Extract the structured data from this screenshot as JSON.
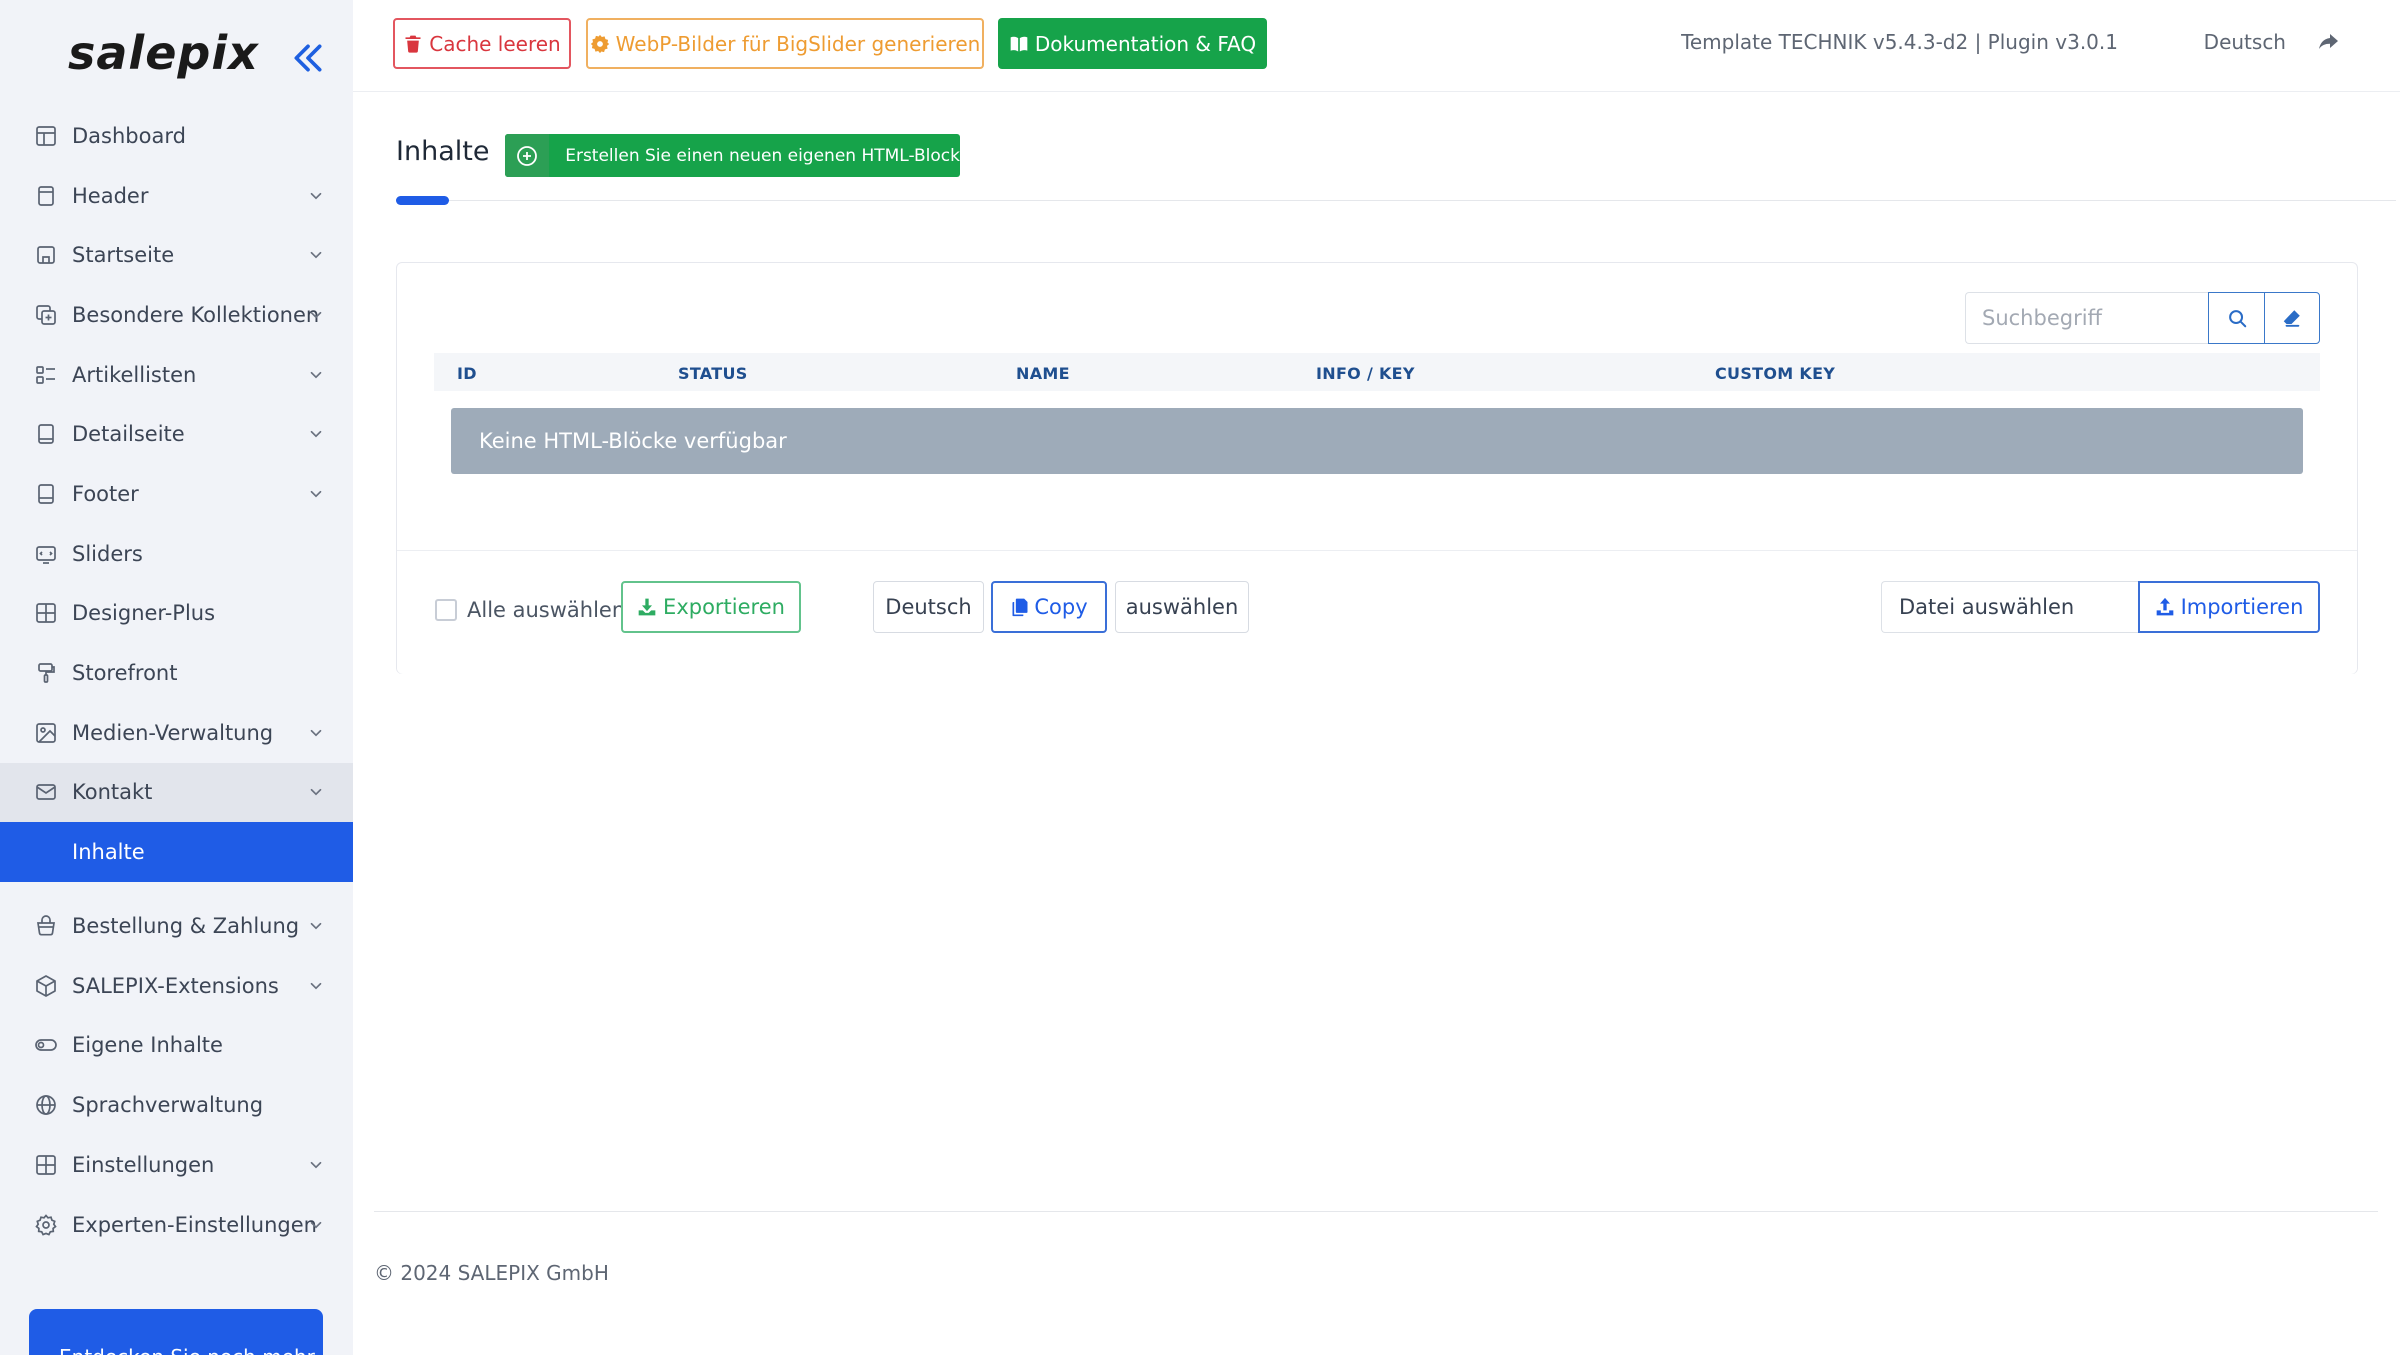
{
  "brand": {
    "name": "salepix"
  },
  "sidebar": {
    "items": [
      {
        "label": "Dashboard",
        "icon": "layout-icon",
        "chevron": false
      },
      {
        "label": "Header",
        "icon": "header-icon",
        "chevron": true
      },
      {
        "label": "Startseite",
        "icon": "home-icon",
        "chevron": true
      },
      {
        "label": "Besondere Kollektionen",
        "icon": "collection-icon",
        "chevron": true
      },
      {
        "label": "Artikellisten",
        "icon": "list-icon",
        "chevron": true
      },
      {
        "label": "Detailseite",
        "icon": "tablet-icon",
        "chevron": true
      },
      {
        "label": "Footer",
        "icon": "footer-icon",
        "chevron": true
      },
      {
        "label": "Sliders",
        "icon": "slider-icon",
        "chevron": false
      },
      {
        "label": "Designer-Plus",
        "icon": "grid-plus-icon",
        "chevron": false
      },
      {
        "label": "Storefront",
        "icon": "paint-roller-icon",
        "chevron": false
      },
      {
        "label": "Medien-Verwaltung",
        "icon": "image-icon",
        "chevron": true
      },
      {
        "label": "Kontakt",
        "icon": "mail-icon",
        "chevron": true,
        "open": true
      }
    ],
    "active_sub": {
      "label": "Inhalte"
    },
    "items_after": [
      {
        "label": "Bestellung & Zahlung",
        "icon": "basket-icon",
        "chevron": true
      },
      {
        "label": "SALEPIX-Extensions",
        "icon": "box-icon",
        "chevron": true
      },
      {
        "label": "Eigene Inhalte",
        "icon": "toggle-icon",
        "chevron": false
      },
      {
        "label": "Sprachverwaltung",
        "icon": "globe-icon",
        "chevron": false
      },
      {
        "label": "Einstellungen",
        "icon": "grid-icon",
        "chevron": true
      },
      {
        "label": "Experten-Einstellungen",
        "icon": "gear-icon",
        "chevron": true
      }
    ],
    "promo": "Entdecken Sie noch mehr"
  },
  "topbar": {
    "cache_label": "Cache leeren",
    "webp_label": "WebP-Bilder für BigSlider generieren",
    "docs_label": "Dokumentation & FAQ",
    "version": "Template TECHNIK v5.4.3-d2 | Plugin v3.0.1",
    "language": "Deutsch"
  },
  "content": {
    "title": "Inhalte",
    "create_label": "Erstellen Sie einen neuen eigenen HTML-Block"
  },
  "search": {
    "placeholder": "Suchbegriff",
    "value": ""
  },
  "table": {
    "columns": [
      "ID",
      "STATUS",
      "NAME",
      "INFO / KEY",
      "CUSTOM KEY"
    ],
    "empty_message": "Keine HTML-Blöcke verfügbar"
  },
  "bulk": {
    "select_all_label": "Alle auswählen",
    "export_label": "Exportieren",
    "language_label": "Deutsch",
    "copy_label": "Copy",
    "choose_label": "auswählen",
    "file_label": "Datei auswählen",
    "import_label": "Importieren"
  },
  "footer": {
    "copyright": "© 2024 SALEPIX GmbH"
  },
  "colors": {
    "accent": "#1f5ce6",
    "success": "#16a34a",
    "danger": "#d9363e",
    "warning": "#ee9c32",
    "sidebar_bg": "#f1f3f8",
    "empty_row": "#9eabb9"
  }
}
